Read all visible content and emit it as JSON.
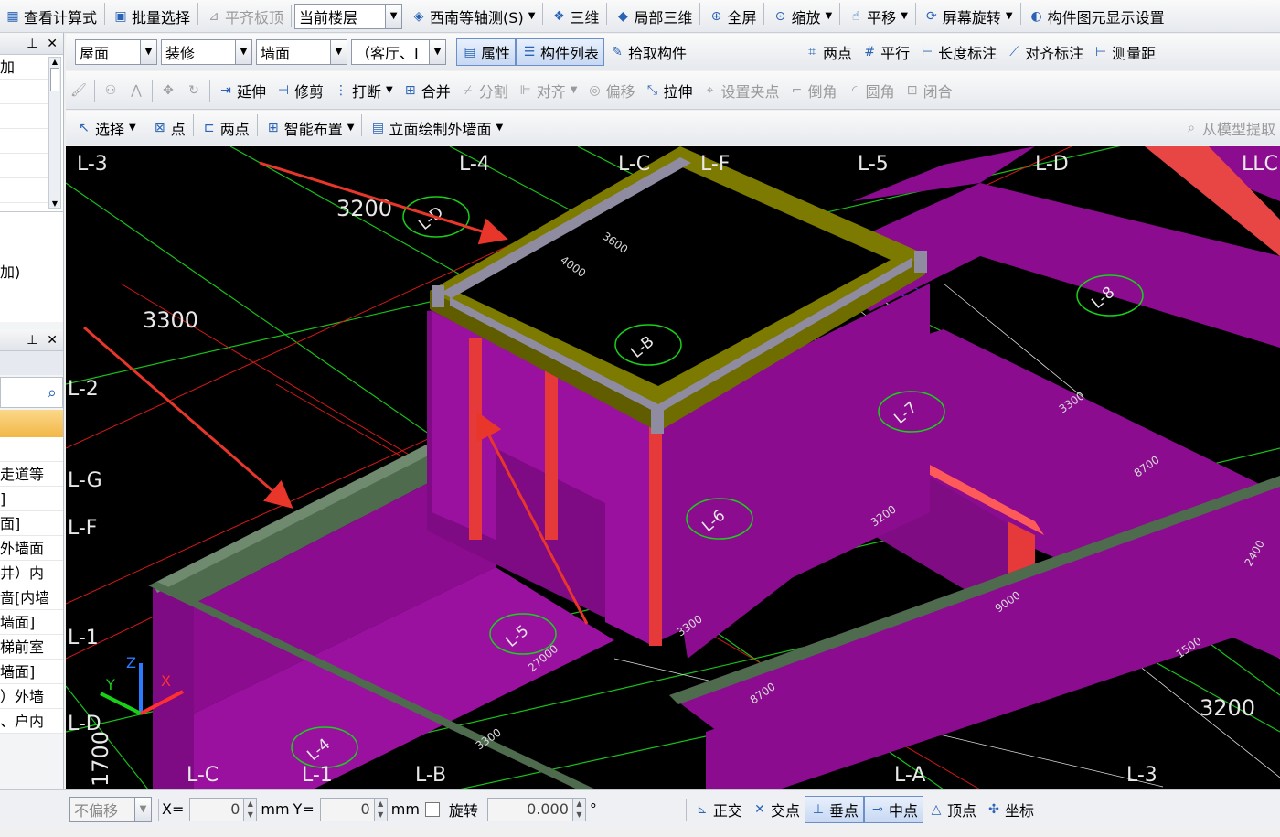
{
  "toolbar1": {
    "items": [
      {
        "name": "view-formula-button",
        "icon": "formula-icon",
        "label": "查看计算式",
        "dis": false
      },
      {
        "name": "batch-select-button",
        "icon": "batch-select-icon",
        "label": "批量选择",
        "dis": false
      },
      {
        "name": "align-slab-top-button",
        "icon": "align-slab-icon",
        "label": "平齐板顶",
        "dis": true
      }
    ],
    "floor_label": "当前楼层",
    "items2": [
      {
        "name": "view-direction-dropdown",
        "icon": "iso-view-icon",
        "label": "西南等轴测(S)",
        "arrow": true
      },
      {
        "name": "3d-button",
        "icon": "3d-icon",
        "label": "三维",
        "arrow": false
      },
      {
        "name": "local-3d-button",
        "icon": "local-3d-icon",
        "label": "局部三维",
        "arrow": false
      },
      {
        "name": "fullscreen-button",
        "icon": "fullscreen-icon",
        "label": "全屏",
        "arrow": false
      },
      {
        "name": "zoom-dropdown",
        "icon": "zoom-icon",
        "label": "缩放",
        "arrow": true
      },
      {
        "name": "pan-dropdown",
        "icon": "pan-icon",
        "label": "平移",
        "arrow": true
      },
      {
        "name": "screen-rotate-dropdown",
        "icon": "rotate-icon",
        "label": "屏幕旋转",
        "arrow": true
      },
      {
        "name": "element-display-settings-button",
        "icon": "display-settings-icon",
        "label": "构件图元显示设置",
        "arrow": false
      }
    ]
  },
  "toolbar2": {
    "combo1": "屋面",
    "combo2": "装修",
    "combo3": "墙面",
    "combo4": "（客厅、I",
    "properties": "属性",
    "component_list": "构件列表",
    "pick": "拾取构件",
    "right": [
      {
        "name": "two-point-axis-button",
        "icon": "two-point-axis-icon",
        "label": "两点"
      },
      {
        "name": "parallel-axis-button",
        "icon": "parallel-axis-icon",
        "label": "平行"
      },
      {
        "name": "length-dimension-button",
        "icon": "length-dim-icon",
        "label": "长度标注"
      },
      {
        "name": "aligned-dimension-button",
        "icon": "aligned-dim-icon",
        "label": "对齐标注"
      },
      {
        "name": "measure-distance-button",
        "icon": "measure-icon",
        "label": "测量距"
      }
    ]
  },
  "toolbar3": {
    "items": [
      {
        "name": "extend-button",
        "icon": "extend-icon",
        "label": "延伸",
        "dis": false,
        "arrow": false
      },
      {
        "name": "trim-button",
        "icon": "trim-icon",
        "label": "修剪",
        "dis": false,
        "arrow": false
      },
      {
        "name": "break-button",
        "icon": "break-icon",
        "label": "打断",
        "dis": false,
        "arrow": true
      },
      {
        "name": "merge-button",
        "icon": "merge-icon",
        "label": "合并",
        "dis": false,
        "arrow": false
      },
      {
        "name": "split-button",
        "icon": "split-icon",
        "label": "分割",
        "dis": true,
        "arrow": false
      },
      {
        "name": "align-dropdown",
        "icon": "align-icon",
        "label": "对齐",
        "dis": true,
        "arrow": true
      },
      {
        "name": "offset-button",
        "icon": "offset-icon",
        "label": "偏移",
        "dis": true,
        "arrow": false
      },
      {
        "name": "stretch-button",
        "icon": "stretch-icon",
        "label": "拉伸",
        "dis": false,
        "arrow": false
      },
      {
        "name": "set-grip-button",
        "icon": "grip-icon",
        "label": "设置夹点",
        "dis": true,
        "arrow": false
      },
      {
        "name": "chamfer-button",
        "icon": "chamfer-icon",
        "label": "倒角",
        "dis": true,
        "arrow": false
      },
      {
        "name": "fillet-button",
        "icon": "fillet-icon",
        "label": "圆角",
        "dis": true,
        "arrow": false
      },
      {
        "name": "close-button",
        "icon": "close-shape-icon",
        "label": "闭合",
        "dis": true,
        "arrow": false
      }
    ]
  },
  "toolbar4": {
    "items": [
      {
        "name": "select-button",
        "icon": "cursor-icon",
        "label": "选择",
        "arrow": true
      },
      {
        "name": "point-button",
        "icon": "point-icon",
        "label": "点",
        "arrow": false
      },
      {
        "name": "two-point-button",
        "icon": "two-point-icon",
        "label": "两点",
        "arrow": false
      },
      {
        "name": "smart-layout-dropdown",
        "icon": "smart-layout-icon",
        "label": "智能布置",
        "arrow": true
      },
      {
        "name": "elevation-draw-dropdown",
        "icon": "elevation-icon",
        "label": "立面绘制外墙面",
        "arrow": true
      }
    ],
    "right": "从模型提取"
  },
  "left_panel": {
    "rows_top": [
      "加",
      "",
      "",
      "",
      "",
      ""
    ],
    "text_mid": "加)",
    "search_placeholder": "",
    "rows": [
      "",
      "走道等",
      "]",
      "面]",
      "外墙面",
      "井）内",
      "啬[内墙",
      "墙面]",
      "梯前室",
      "墙面]",
      "）外墙",
      "、户内"
    ]
  },
  "viewport": {
    "grid_labels": [
      "L-3",
      "L-4",
      "L-C",
      "L-F",
      "L-5",
      "L-D",
      "LLC",
      "L-2",
      "L-G",
      "L-F",
      "L-1",
      "L-D",
      "L-C",
      "L-1",
      "L-B",
      "L-A",
      "L-3"
    ],
    "dims": [
      "3200",
      "3300",
      "3200",
      "1700"
    ],
    "circle_labels": [
      "L-D",
      "L-B",
      "L-8",
      "L-7",
      "L-6",
      "L-5",
      "L-4"
    ],
    "small_dims": [
      "3600",
      "4000",
      "3300",
      "8700",
      "3200",
      "9000",
      "1500",
      "3300",
      "27000",
      "8700",
      "3300",
      "2400"
    ],
    "axis": [
      "Z",
      "Y",
      "X"
    ]
  },
  "status": {
    "offset": "不偏移",
    "x_label": "X=",
    "x_val": "0",
    "mm": "mm",
    "y_label": "Y=",
    "y_val": "0",
    "rotate_label": "旋转",
    "rotate_val": "0.000",
    "deg": "°",
    "snaps": [
      {
        "name": "ortho-button",
        "icon": "ortho-icon",
        "label": "正交",
        "pressed": false
      },
      {
        "name": "intersection-snap-button",
        "icon": "intersection-icon",
        "label": "交点",
        "pressed": false
      },
      {
        "name": "perpendicular-snap-button",
        "icon": "perpendicular-icon",
        "label": "垂点",
        "pressed": true
      },
      {
        "name": "midpoint-snap-button",
        "icon": "midpoint-icon",
        "label": "中点",
        "pressed": true
      },
      {
        "name": "vertex-snap-button",
        "icon": "vertex-icon",
        "label": "顶点",
        "pressed": false
      },
      {
        "name": "coordinate-snap-button",
        "icon": "coordinate-icon",
        "label": "坐标",
        "pressed": false
      }
    ]
  },
  "colors": {
    "wall": "#8b0c8f",
    "beam": "#7c7a00",
    "column": "#e63a3a",
    "grid": "#19d019",
    "arrow": "#e8362b"
  }
}
